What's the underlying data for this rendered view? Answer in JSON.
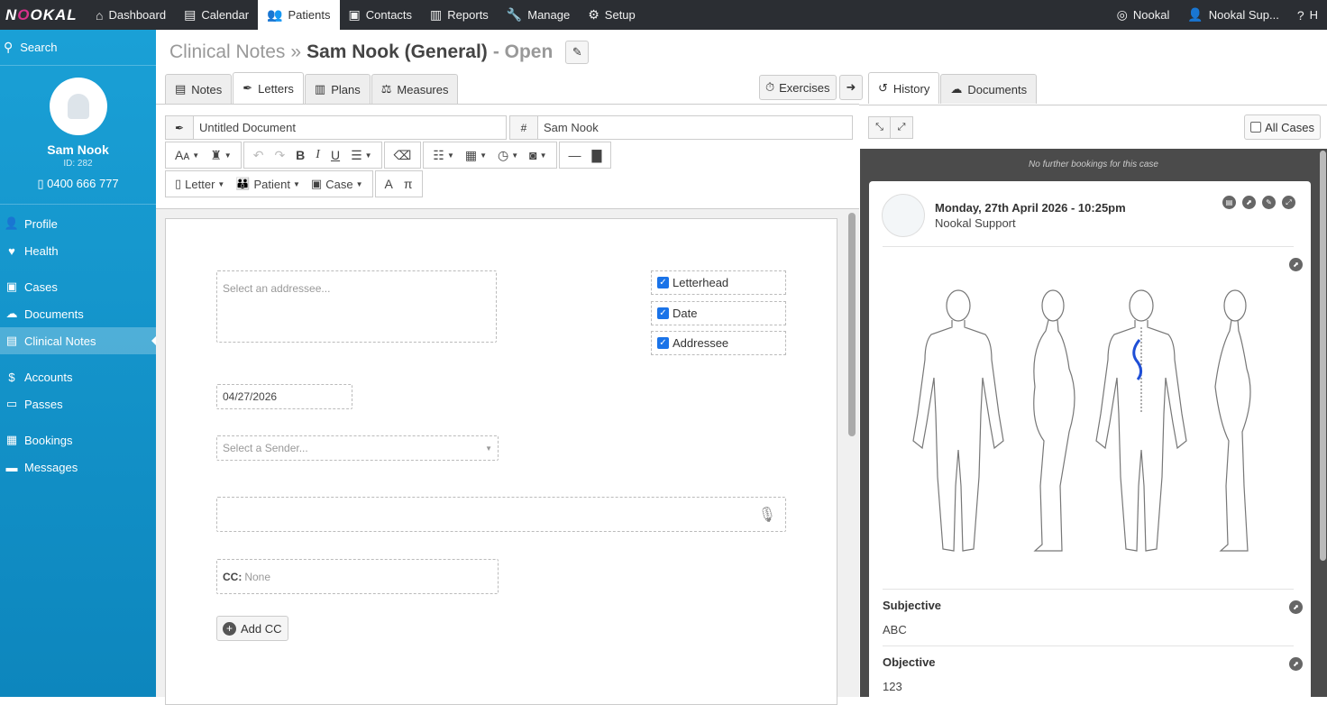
{
  "topbar": {
    "logo": "NOOKAL",
    "nav": [
      {
        "label": "Dashboard",
        "icon": "home-icon"
      },
      {
        "label": "Calendar",
        "icon": "calendar-icon"
      },
      {
        "label": "Patients",
        "icon": "users-icon"
      },
      {
        "label": "Contacts",
        "icon": "address-card-icon"
      },
      {
        "label": "Reports",
        "icon": "bar-chart-icon"
      },
      {
        "label": "Manage",
        "icon": "wrench-icon"
      },
      {
        "label": "Setup",
        "icon": "gear-icon"
      }
    ],
    "right": [
      {
        "label": "Nookal",
        "icon": "compass-icon"
      },
      {
        "label": "Nookal Sup...",
        "icon": "user-icon"
      },
      {
        "label": "H",
        "icon": "help-icon"
      }
    ]
  },
  "sidebar": {
    "search": "Search",
    "patient_name": "Sam Nook",
    "patient_id": "ID: 282",
    "phone": "0400 666 777",
    "items": [
      {
        "label": "Profile",
        "icon": "user-icon"
      },
      {
        "label": "Health",
        "icon": "heartbeat-icon"
      },
      {
        "label": "Cases",
        "icon": "briefcase-icon"
      },
      {
        "label": "Documents",
        "icon": "cloud-icon"
      },
      {
        "label": "Clinical Notes",
        "icon": "clipboard-icon"
      },
      {
        "label": "Accounts",
        "icon": "dollar-icon"
      },
      {
        "label": "Passes",
        "icon": "ticket-icon"
      },
      {
        "label": "Bookings",
        "icon": "calendar-icon"
      },
      {
        "label": "Messages",
        "icon": "comment-icon"
      }
    ]
  },
  "header": {
    "section": "Clinical Notes",
    "sep": "»",
    "patient_case": "Sam Nook (General)",
    "status": "- Open"
  },
  "tabs": [
    "Notes",
    "Letters",
    "Plans",
    "Measures"
  ],
  "right_tabs": {
    "exercises": "Exercises",
    "history": "History",
    "documents": "Documents"
  },
  "doc": {
    "title_value": "Untitled Document",
    "patient_value": "Sam Nook",
    "hash": "#"
  },
  "toolbar2": {
    "letter": "Letter",
    "patient": "Patient",
    "case": "Case"
  },
  "letter": {
    "addressee_placeholder": "Select an addressee...",
    "options": [
      "Letterhead",
      "Date",
      "Addressee"
    ],
    "date": "04/27/2026",
    "sender_placeholder": "Select a Sender...",
    "cc_label": "CC:",
    "cc_value": "None",
    "add_cc": "Add CC"
  },
  "history": {
    "all_cases": "All Cases",
    "no_bookings": "No further bookings for this case",
    "entry_date": "Monday, 27th April 2026 - 10:25pm",
    "entry_by": "Nookal Support",
    "subjective_label": "Subjective",
    "subjective_value": "ABC",
    "objective_label": "Objective",
    "objective_value": "123"
  }
}
